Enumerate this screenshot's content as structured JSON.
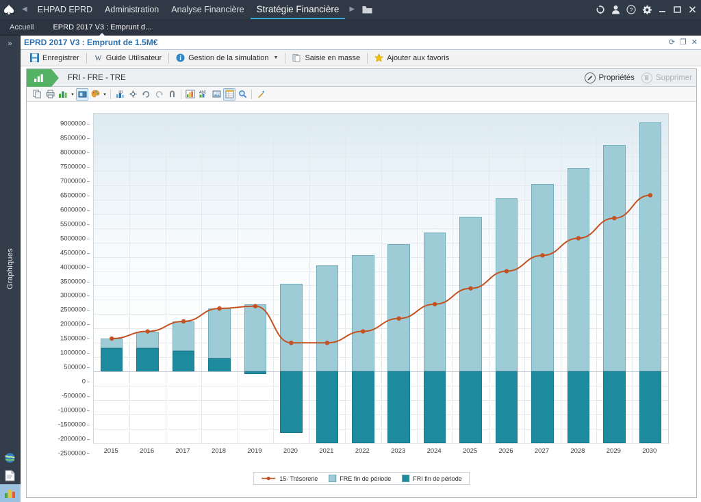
{
  "menubar": {
    "back_arrow": "◀",
    "forward_arrow": "▶",
    "items": [
      {
        "label": "EHPAD EPRD",
        "active": false
      },
      {
        "label": "Administration",
        "active": false
      },
      {
        "label": "Analyse Financière",
        "active": false
      },
      {
        "label": "Stratégie Financière",
        "active": true
      }
    ],
    "folder_icon": "folder-icon",
    "right_icons": [
      {
        "name": "refresh-icon",
        "glyph": "⟳"
      },
      {
        "name": "user-icon",
        "glyph": "☰"
      },
      {
        "name": "help-icon",
        "glyph": "?"
      },
      {
        "name": "settings-gear-icon",
        "glyph": "⚙"
      },
      {
        "name": "minimize-icon",
        "glyph": "—"
      },
      {
        "name": "maximize-icon",
        "glyph": "□"
      },
      {
        "name": "close-icon",
        "glyph": "✕"
      }
    ]
  },
  "tabs": [
    {
      "label": "Accueil",
      "selected": false
    },
    {
      "label": "EPRD 2017 V3 : Emprunt d...",
      "selected": true
    }
  ],
  "doctitle": {
    "text": "EPRD 2017 V3 : Emprunt de 1.5M€",
    "refresh_icon": "⟳",
    "restore_icon": "❐",
    "close_icon": "✕"
  },
  "sidebar": {
    "expand_label": "»",
    "vertical_label": "Graphiques",
    "bottom_items": [
      {
        "name": "globe-icon",
        "selected": false
      },
      {
        "name": "document-icon",
        "selected": false
      },
      {
        "name": "chart-icon",
        "selected": true
      }
    ]
  },
  "toolbar": {
    "items": [
      {
        "label": "Enregistrer",
        "icon": "save-icon",
        "dropdown": false
      },
      {
        "label": "Guide Utilisateur",
        "icon": "word-doc-icon",
        "dropdown": false
      },
      {
        "label": "Gestion de la simulation",
        "icon": "info-icon",
        "dropdown": true
      },
      {
        "label": "Saisie en masse",
        "icon": "paste-icon",
        "dropdown": false
      },
      {
        "label": "Ajouter aux favoris",
        "icon": "star-icon",
        "dropdown": false
      }
    ]
  },
  "panel": {
    "tab_icon": "bar-chart-icon",
    "title": "FRI - FRE - TRE",
    "properties_label": "Propriétés",
    "properties_icon": "pencil-icon",
    "delete_label": "Supprimer",
    "delete_icon": "trash-icon",
    "delete_disabled": true
  },
  "chart_toolbar": {
    "buttons": [
      {
        "name": "copy-icon",
        "glyph": "❏",
        "active": false
      },
      {
        "name": "print-icon",
        "glyph": "⎙",
        "active": false
      },
      {
        "name": "chart-type-icon",
        "glyph": "▮",
        "active": false
      },
      {
        "name": "chart-type-dropdown-caret",
        "glyph": "▾",
        "active": false
      },
      {
        "name": "select-mode-icon",
        "glyph": "▩",
        "active": true
      },
      {
        "name": "palette-icon",
        "glyph": "✐",
        "active": false
      },
      {
        "name": "palette-dropdown-caret",
        "glyph": "▾",
        "active": false
      },
      {
        "name": "three-d-icon",
        "glyph": "3D",
        "active": false
      },
      {
        "name": "move-icon",
        "glyph": "✥",
        "active": false
      },
      {
        "name": "rotate-icon",
        "glyph": "↻",
        "active": false
      },
      {
        "name": "undo-rotate-icon",
        "glyph": "↺",
        "active": false
      },
      {
        "name": "magnet-icon",
        "glyph": "⌐",
        "active": false
      },
      {
        "name": "legend-icon",
        "glyph": "▤",
        "active": false
      },
      {
        "name": "abc-icon",
        "glyph": "ABC",
        "active": false
      },
      {
        "name": "image-icon",
        "glyph": "▣",
        "active": false
      },
      {
        "name": "data-table-icon",
        "glyph": "☰",
        "active": true
      },
      {
        "name": "zoom-icon",
        "glyph": "⌕",
        "active": false
      },
      {
        "name": "wand-icon",
        "glyph": "✎",
        "active": false
      }
    ]
  },
  "chart_data": {
    "type": "bar",
    "title": "FRI - FRE - TRE",
    "xlabel": "",
    "ylabel": "",
    "stacked": true,
    "grid": true,
    "legend_position": "bottom",
    "ylim": [
      -2500000,
      9000000
    ],
    "ystep": 500000,
    "categories": [
      "2015",
      "2016",
      "2017",
      "2018",
      "2019",
      "2020",
      "2021",
      "2022",
      "2023",
      "2024",
      "2025",
      "2026",
      "2027",
      "2028",
      "2029",
      "2030"
    ],
    "yticks": [
      9000000,
      8500000,
      8000000,
      7500000,
      7000000,
      6500000,
      6000000,
      5500000,
      5000000,
      4500000,
      4000000,
      3500000,
      3000000,
      2500000,
      2000000,
      1500000,
      1000000,
      500000,
      0,
      -500000,
      -1000000,
      -1500000,
      -2000000,
      -2500000
    ],
    "series": [
      {
        "name": "FRI fin de période",
        "type": "bar",
        "color": "#1d8a9e",
        "values": [
          820000,
          820000,
          720000,
          450000,
          -80000,
          -2150000,
          -2500000,
          -2500000,
          -2500000,
          -2500000,
          -2500000,
          -2500000,
          -2500000,
          -2500000,
          -2500000,
          -2500000
        ]
      },
      {
        "name": "FRE fin de période",
        "type": "bar",
        "color": "#9dcbd6",
        "values": [
          1150000,
          1400000,
          1750000,
          2200000,
          2350000,
          3050000,
          3700000,
          4050000,
          4450000,
          4850000,
          5400000,
          6050000,
          6550000,
          7100000,
          7900000,
          8700000
        ]
      },
      {
        "name": "15- Trésorerie",
        "type": "line",
        "color": "#c4511f",
        "values": [
          1150000,
          1400000,
          1750000,
          2200000,
          2280000,
          1000000,
          1000000,
          1400000,
          1850000,
          2350000,
          2900000,
          3500000,
          4050000,
          4650000,
          5350000,
          6150000
        ]
      }
    ],
    "legend": [
      {
        "label": "15- Trésorerie",
        "type": "line",
        "color": "#c4511f"
      },
      {
        "label": "FRE fin de période",
        "type": "swatch",
        "color": "#9dcbd6"
      },
      {
        "label": "FRI fin de période",
        "type": "swatch",
        "color": "#1d8a9e"
      }
    ]
  }
}
